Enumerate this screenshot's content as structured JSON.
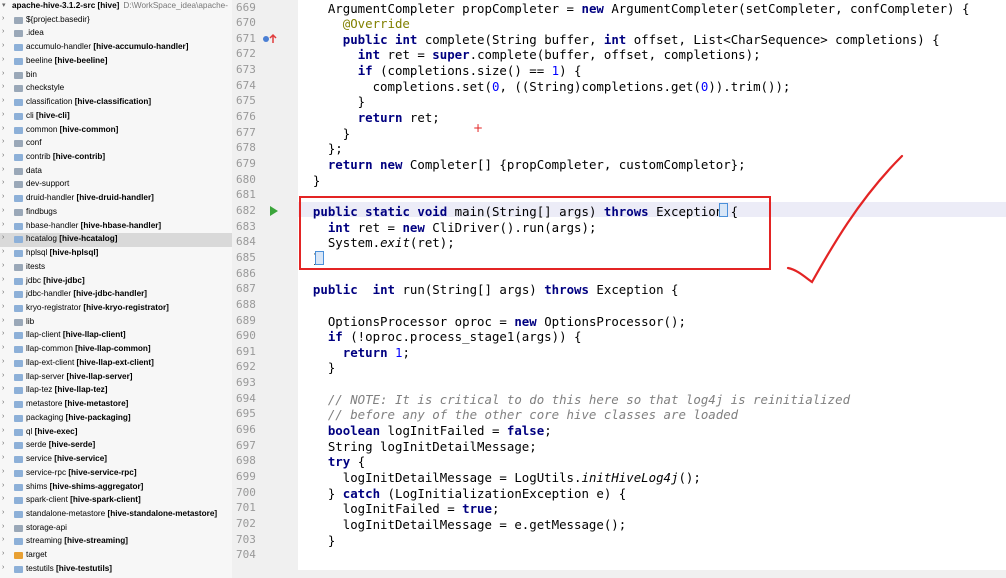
{
  "project_tree": {
    "root": {
      "name": "apache-hive-3.1.2-src [hive]",
      "path": "D:\\WorkSpace_idea\\apache-"
    },
    "items": [
      {
        "name": "${project.basedir}",
        "module": ""
      },
      {
        "name": ".idea",
        "module": ""
      },
      {
        "name": "accumulo-handler",
        "module": "[hive-accumulo-handler]"
      },
      {
        "name": "beeline",
        "module": "[hive-beeline]"
      },
      {
        "name": "bin",
        "module": ""
      },
      {
        "name": "checkstyle",
        "module": ""
      },
      {
        "name": "classification",
        "module": "[hive-classification]"
      },
      {
        "name": "cli",
        "module": "[hive-cli]"
      },
      {
        "name": "common",
        "module": "[hive-common]"
      },
      {
        "name": "conf",
        "module": ""
      },
      {
        "name": "contrib",
        "module": "[hive-contrib]"
      },
      {
        "name": "data",
        "module": ""
      },
      {
        "name": "dev-support",
        "module": ""
      },
      {
        "name": "druid-handler",
        "module": "[hive-druid-handler]"
      },
      {
        "name": "findbugs",
        "module": ""
      },
      {
        "name": "hbase-handler",
        "module": "[hive-hbase-handler]"
      },
      {
        "name": "hcatalog",
        "module": "[hive-hcatalog]"
      },
      {
        "name": "hplsql",
        "module": "[hive-hplsql]"
      },
      {
        "name": "itests",
        "module": ""
      },
      {
        "name": "jdbc",
        "module": "[hive-jdbc]"
      },
      {
        "name": "jdbc-handler",
        "module": "[hive-jdbc-handler]"
      },
      {
        "name": "kryo-registrator",
        "module": "[hive-kryo-registrator]"
      },
      {
        "name": "lib",
        "module": ""
      },
      {
        "name": "llap-client",
        "module": "[hive-llap-client]"
      },
      {
        "name": "llap-common",
        "module": "[hive-llap-common]"
      },
      {
        "name": "llap-ext-client",
        "module": "[hive-llap-ext-client]"
      },
      {
        "name": "llap-server",
        "module": "[hive-llap-server]"
      },
      {
        "name": "llap-tez",
        "module": "[hive-llap-tez]"
      },
      {
        "name": "metastore",
        "module": "[hive-metastore]"
      },
      {
        "name": "packaging",
        "module": "[hive-packaging]"
      },
      {
        "name": "ql",
        "module": "[hive-exec]"
      },
      {
        "name": "serde",
        "module": "[hive-serde]"
      },
      {
        "name": "service",
        "module": "[hive-service]"
      },
      {
        "name": "service-rpc",
        "module": "[hive-service-rpc]"
      },
      {
        "name": "shims",
        "module": "[hive-shims-aggregator]"
      },
      {
        "name": "spark-client",
        "module": "[hive-spark-client]"
      },
      {
        "name": "standalone-metastore",
        "module": "[hive-standalone-metastore]"
      },
      {
        "name": "storage-api",
        "module": ""
      },
      {
        "name": "streaming",
        "module": "[hive-streaming]"
      },
      {
        "name": "target",
        "module": ""
      },
      {
        "name": "testutils",
        "module": "[hive-testutils]"
      }
    ],
    "selected_item": "hcatalog"
  },
  "editor": {
    "line_numbers": [
      "669",
      "670",
      "671",
      "672",
      "673",
      "674",
      "675",
      "676",
      "677",
      "678",
      "679",
      "680",
      "681",
      "682",
      "683",
      "684",
      "685",
      "686",
      "687",
      "688",
      "689",
      "690",
      "691",
      "692",
      "693",
      "694",
      "695",
      "696",
      "697",
      "698",
      "699",
      "700",
      "701",
      "702",
      "703",
      "704"
    ],
    "code_lines": [
      [
        {
          "t": "    ArgumentCompleter propCompleter = ",
          "c": ""
        },
        {
          "t": "new",
          "c": "kw"
        },
        {
          "t": " ArgumentCompleter(setCompleter, confCompleter) {",
          "c": ""
        }
      ],
      [
        {
          "t": "      @Override",
          "c": "ann"
        }
      ],
      [
        {
          "t": "      ",
          "c": ""
        },
        {
          "t": "public int",
          "c": "kw"
        },
        {
          "t": " complete(String buffer, ",
          "c": ""
        },
        {
          "t": "int",
          "c": "kw"
        },
        {
          "t": " offset, List<CharSequence> completions) {",
          "c": ""
        }
      ],
      [
        {
          "t": "        ",
          "c": ""
        },
        {
          "t": "int",
          "c": "kw"
        },
        {
          "t": " ret = ",
          "c": ""
        },
        {
          "t": "super",
          "c": "kw"
        },
        {
          "t": ".complete(buffer, offset, completions);",
          "c": ""
        }
      ],
      [
        {
          "t": "        ",
          "c": ""
        },
        {
          "t": "if",
          "c": "kw"
        },
        {
          "t": " (completions.size() == ",
          "c": ""
        },
        {
          "t": "1",
          "c": "num"
        },
        {
          "t": ") {",
          "c": ""
        }
      ],
      [
        {
          "t": "          completions.set(",
          "c": ""
        },
        {
          "t": "0",
          "c": "num"
        },
        {
          "t": ", ((String)completions.get(",
          "c": ""
        },
        {
          "t": "0",
          "c": "num"
        },
        {
          "t": ")).trim());",
          "c": ""
        }
      ],
      [
        {
          "t": "        }",
          "c": ""
        }
      ],
      [
        {
          "t": "        ",
          "c": ""
        },
        {
          "t": "return",
          "c": "kw"
        },
        {
          "t": " ret;",
          "c": ""
        }
      ],
      [
        {
          "t": "      }",
          "c": ""
        }
      ],
      [
        {
          "t": "    };",
          "c": ""
        }
      ],
      [
        {
          "t": "    ",
          "c": ""
        },
        {
          "t": "return new",
          "c": "kw"
        },
        {
          "t": " Completer[] {propCompleter, customCompletor};",
          "c": ""
        }
      ],
      [
        {
          "t": "  }",
          "c": ""
        }
      ],
      [
        {
          "t": "",
          "c": ""
        }
      ],
      [
        {
          "t": "  ",
          "c": ""
        },
        {
          "t": "public static void",
          "c": "kw"
        },
        {
          "t": " main(String[] args) ",
          "c": ""
        },
        {
          "t": "throws",
          "c": "kw"
        },
        {
          "t": " Exception {",
          "c": ""
        }
      ],
      [
        {
          "t": "    ",
          "c": ""
        },
        {
          "t": "int",
          "c": "kw"
        },
        {
          "t": " ret = ",
          "c": ""
        },
        {
          "t": "new",
          "c": "kw"
        },
        {
          "t": " CliDriver().run(args);",
          "c": ""
        }
      ],
      [
        {
          "t": "    System.",
          "c": ""
        },
        {
          "t": "exit",
          "c": "ital"
        },
        {
          "t": "(ret);",
          "c": ""
        }
      ],
      [
        {
          "t": "  }",
          "c": ""
        }
      ],
      [
        {
          "t": "",
          "c": ""
        }
      ],
      [
        {
          "t": "  ",
          "c": ""
        },
        {
          "t": "public",
          "c": "kw"
        },
        {
          "t": "  ",
          "c": ""
        },
        {
          "t": "int",
          "c": "kw"
        },
        {
          "t": " run(String[] args) ",
          "c": ""
        },
        {
          "t": "throws",
          "c": "kw"
        },
        {
          "t": " Exception {",
          "c": ""
        }
      ],
      [
        {
          "t": "",
          "c": ""
        }
      ],
      [
        {
          "t": "    OptionsProcessor oproc = ",
          "c": ""
        },
        {
          "t": "new",
          "c": "kw"
        },
        {
          "t": " OptionsProcessor();",
          "c": ""
        }
      ],
      [
        {
          "t": "    ",
          "c": ""
        },
        {
          "t": "if",
          "c": "kw"
        },
        {
          "t": " (!oproc.process_stage1(args)) {",
          "c": ""
        }
      ],
      [
        {
          "t": "      ",
          "c": ""
        },
        {
          "t": "return",
          "c": "kw"
        },
        {
          "t": " ",
          "c": ""
        },
        {
          "t": "1",
          "c": "num"
        },
        {
          "t": ";",
          "c": ""
        }
      ],
      [
        {
          "t": "    }",
          "c": ""
        }
      ],
      [
        {
          "t": "",
          "c": ""
        }
      ],
      [
        {
          "t": "    // NOTE: It is critical to do this here so that log4j is reinitialized",
          "c": "com"
        }
      ],
      [
        {
          "t": "    // before any of the other core hive classes are loaded",
          "c": "com"
        }
      ],
      [
        {
          "t": "    ",
          "c": ""
        },
        {
          "t": "boolean",
          "c": "kw"
        },
        {
          "t": " logInitFailed = ",
          "c": ""
        },
        {
          "t": "false",
          "c": "kw"
        },
        {
          "t": ";",
          "c": ""
        }
      ],
      [
        {
          "t": "    String logInitDetailMessage;",
          "c": ""
        }
      ],
      [
        {
          "t": "    ",
          "c": ""
        },
        {
          "t": "try",
          "c": "kw"
        },
        {
          "t": " {",
          "c": ""
        }
      ],
      [
        {
          "t": "      logInitDetailMessage = LogUtils.",
          "c": ""
        },
        {
          "t": "initHiveLog4j",
          "c": "ital"
        },
        {
          "t": "();",
          "c": ""
        }
      ],
      [
        {
          "t": "    } ",
          "c": ""
        },
        {
          "t": "catch",
          "c": "kw"
        },
        {
          "t": " (LogInitializationException e) {",
          "c": ""
        }
      ],
      [
        {
          "t": "      logInitFailed = ",
          "c": ""
        },
        {
          "t": "true",
          "c": "kw"
        },
        {
          "t": ";",
          "c": ""
        }
      ],
      [
        {
          "t": "      logInitDetailMessage = e.getMessage();",
          "c": ""
        }
      ],
      [
        {
          "t": "    }",
          "c": ""
        }
      ],
      [
        {
          "t": "",
          "c": ""
        }
      ]
    ],
    "caret_line": "682"
  },
  "colors": {
    "annotation_box": "#e32424",
    "checkmark": "#e32424",
    "run_arrow": "#3ba53b",
    "keyword": "#000080"
  }
}
